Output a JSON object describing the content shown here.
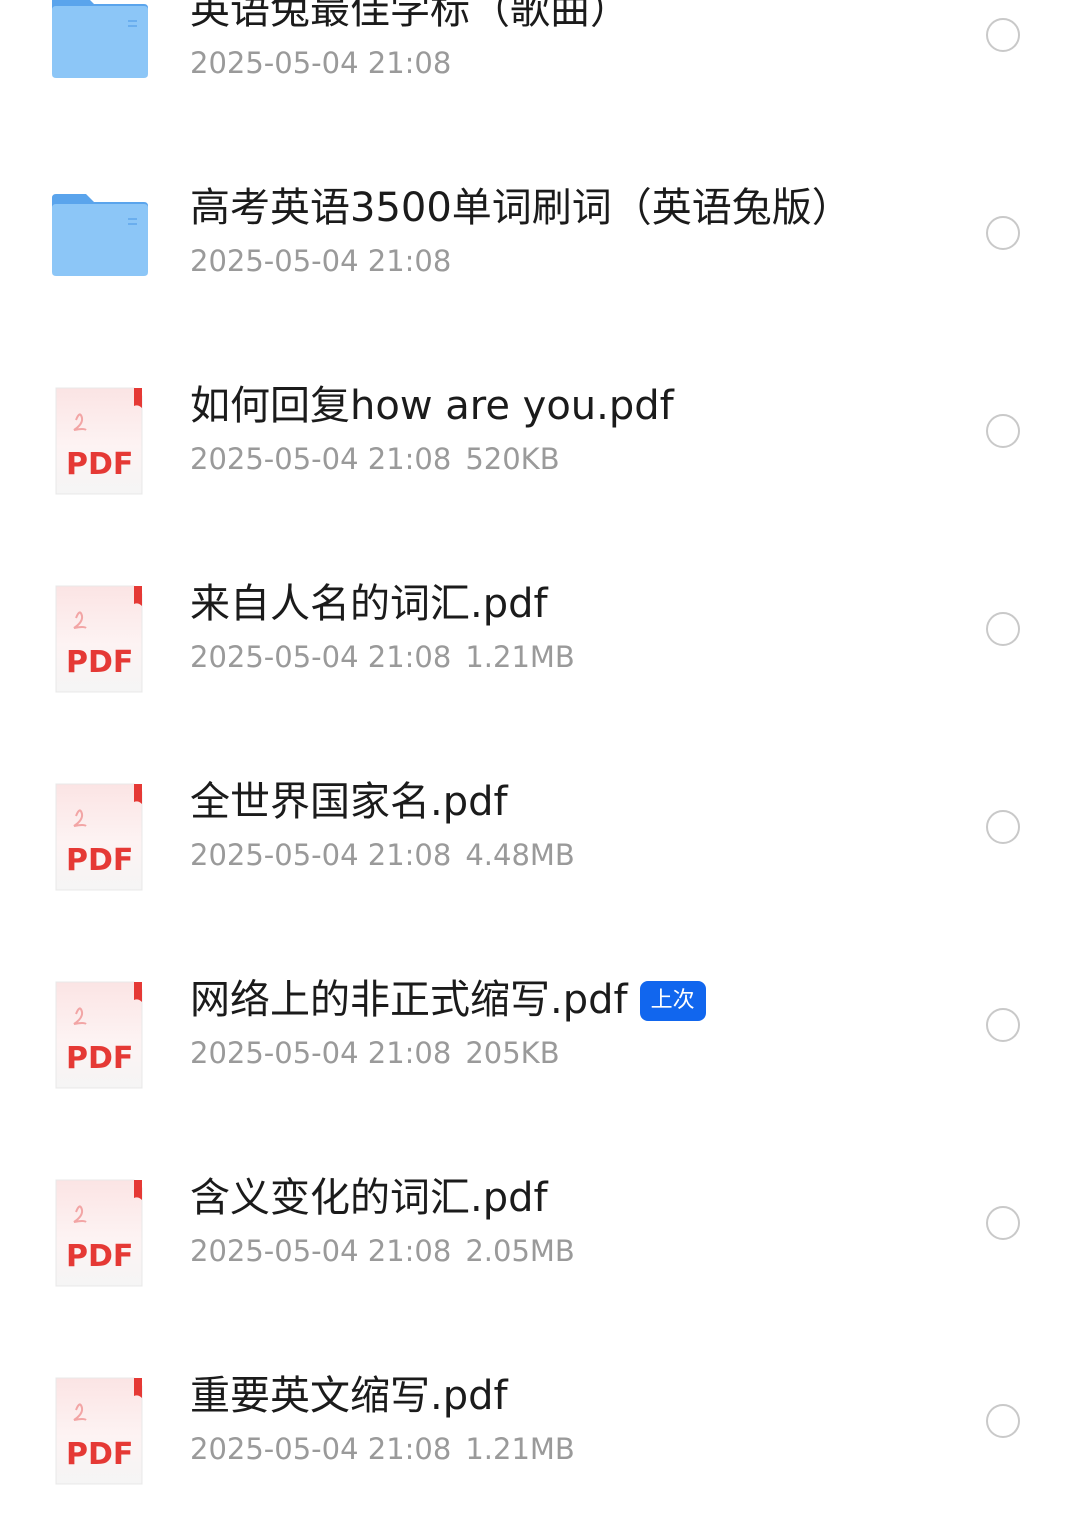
{
  "files": [
    {
      "type": "folder",
      "icon": "folder-icon",
      "name": "英语兔最佳学标（歌曲）",
      "date": "2025-05-04 21:08",
      "size": ""
    },
    {
      "type": "folder",
      "icon": "folder-icon",
      "name": "高考英语3500单词刷词（英语兔版）",
      "date": "2025-05-04 21:08",
      "size": ""
    },
    {
      "type": "pdf",
      "icon": "pdf-file-icon",
      "icon_text": "PDF",
      "name": "如何回复how are you.pdf",
      "date": "2025-05-04 21:08",
      "size": "520KB"
    },
    {
      "type": "pdf",
      "icon": "pdf-file-icon",
      "icon_text": "PDF",
      "name": "来自人名的词汇.pdf",
      "date": "2025-05-04 21:08",
      "size": "1.21MB"
    },
    {
      "type": "pdf",
      "icon": "pdf-file-icon",
      "icon_text": "PDF",
      "name": "全世界国家名.pdf",
      "date": "2025-05-04 21:08",
      "size": "4.48MB"
    },
    {
      "type": "pdf",
      "icon": "pdf-file-icon",
      "icon_text": "PDF",
      "name": "网络上的非正式缩写.pdf",
      "badge": "上次",
      "date": "2025-05-04 21:08",
      "size": "205KB"
    },
    {
      "type": "pdf",
      "icon": "pdf-file-icon",
      "icon_text": "PDF",
      "name": "含义变化的词汇.pdf",
      "date": "2025-05-04 21:08",
      "size": "2.05MB"
    },
    {
      "type": "pdf",
      "icon": "pdf-file-icon",
      "icon_text": "PDF",
      "name": "重要英文缩写.pdf",
      "date": "2025-05-04 21:08",
      "size": "1.21MB"
    }
  ],
  "colors": {
    "badge": "#1166ee",
    "folder": "#7fbdf5",
    "pdf_text": "#e53935",
    "meta_text": "#9a9a9a",
    "radio_border": "#c9c9c9"
  }
}
